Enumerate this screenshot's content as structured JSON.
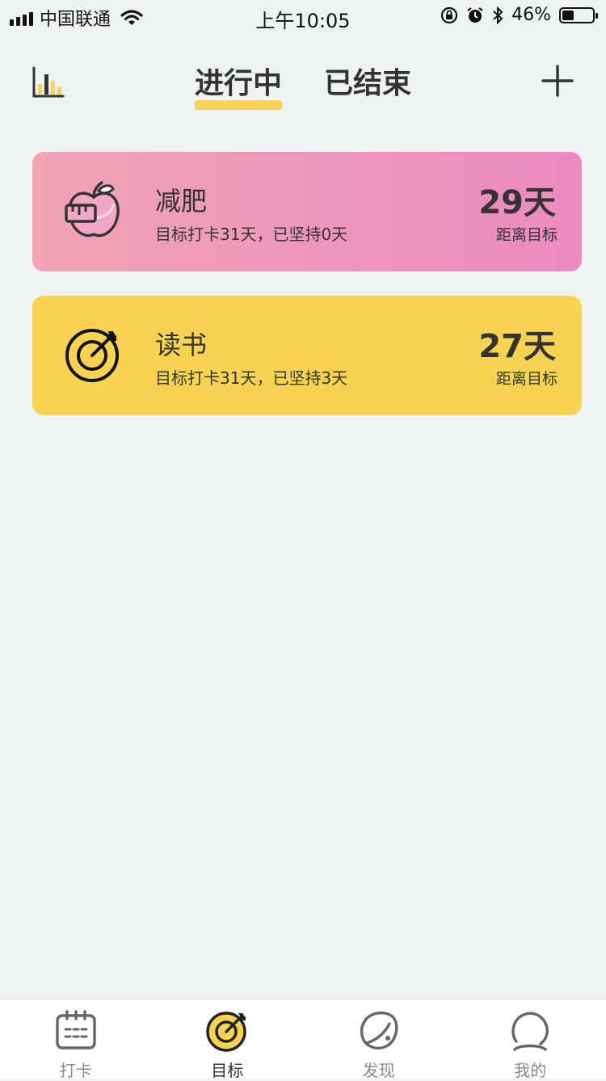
{
  "status_bar": {
    "carrier": "中国联通",
    "time": "上午10:05",
    "battery_percent": "46%",
    "battery_level": 0.46
  },
  "header": {
    "tabs": [
      {
        "label": "进行中",
        "active": true
      },
      {
        "label": "已结束",
        "active": false
      }
    ],
    "stats_icon": "bar-chart-icon",
    "add_icon": "plus-icon"
  },
  "goals": [
    {
      "title": "减肥",
      "subtitle": "目标打卡31天，已坚持0天",
      "days": "29天",
      "days_label": "距离目标",
      "icon": "apple-tape-icon",
      "color_start": "#f0a4b5",
      "color_end": "#ec8ac0"
    },
    {
      "title": "读书",
      "subtitle": "目标打卡31天，已坚持3天",
      "days": "27天",
      "days_label": "距离目标",
      "icon": "target-icon",
      "color": "#f8d352"
    }
  ],
  "tab_bar": {
    "items": [
      {
        "label": "打卡",
        "icon": "calendar-icon",
        "active": false
      },
      {
        "label": "目标",
        "icon": "target-icon",
        "active": true
      },
      {
        "label": "发现",
        "icon": "planet-icon",
        "active": false
      },
      {
        "label": "我的",
        "icon": "person-icon",
        "active": false
      }
    ]
  },
  "colors": {
    "accent": "#f8d352",
    "background": "#eff2f3",
    "text": "#333333"
  }
}
